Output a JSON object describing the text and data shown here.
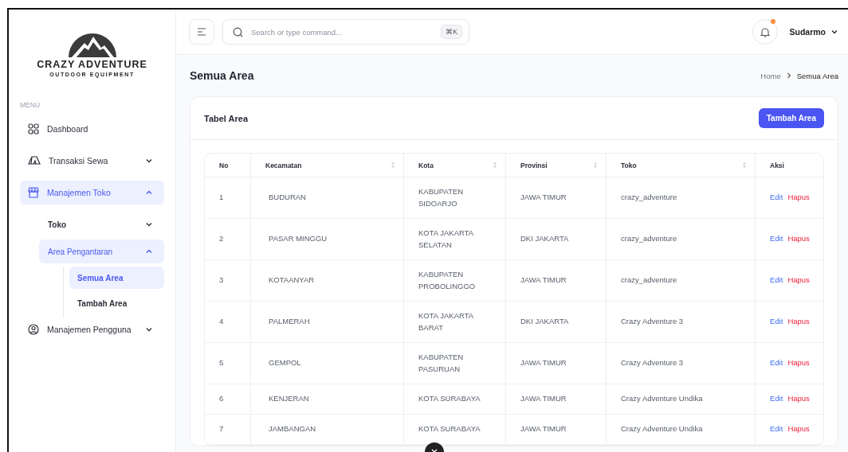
{
  "brand": {
    "name": "CRAZY ADVENTURE",
    "tagline": "OUTDOOR EQUIPMENT"
  },
  "sidebar": {
    "heading": "MENU",
    "items": [
      {
        "kind": "dashboard",
        "label": "Dashboard",
        "active": false
      },
      {
        "kind": "tent",
        "label": "Transaksi Sewa",
        "active": false,
        "expanded": false
      },
      {
        "kind": "store",
        "label": "Manajemen Toko",
        "active": true,
        "expanded": true,
        "children": [
          {
            "label": "Toko",
            "active": false,
            "expanded": false
          },
          {
            "label": "Area Pengantaran",
            "active": true,
            "expanded": true,
            "children": [
              {
                "label": "Semua Area",
                "selected": true
              },
              {
                "label": "Tambah Area",
                "selected": false
              }
            ]
          }
        ]
      },
      {
        "kind": "user",
        "label": "Manajemen Pengguna",
        "active": false,
        "expanded": false
      }
    ]
  },
  "header": {
    "search_placeholder": "Search or type command...",
    "shortcut": "⌘K",
    "notification": true,
    "user": "Sudarmo"
  },
  "page": {
    "title": "Semua Area",
    "breadcrumb": [
      "Home",
      "Semua Area"
    ]
  },
  "card": {
    "title": "Tabel Area",
    "add_button": "Tambah Area"
  },
  "table": {
    "columns": [
      {
        "label": "No",
        "sortable": false
      },
      {
        "label": "Kecamatan",
        "sortable": true
      },
      {
        "label": "Kota",
        "sortable": true
      },
      {
        "label": "Provinsi",
        "sortable": true
      },
      {
        "label": "Toko",
        "sortable": true
      },
      {
        "label": "Aksi",
        "sortable": false
      }
    ],
    "rows": [
      {
        "no": "1",
        "kecamatan": "BUDURAN",
        "kota": "KABUPATEN SIDOARJO",
        "provinsi": "JAWA TIMUR",
        "toko": "crazy_adventure",
        "actions": [
          "Edit",
          "Hapus"
        ]
      },
      {
        "no": "2",
        "kecamatan": "PASAR MINGGU",
        "kota": "KOTA JAKARTA SELATAN",
        "provinsi": "DKI JAKARTA",
        "toko": "crazy_adventure",
        "actions": [
          "Edit",
          "Hapus"
        ]
      },
      {
        "no": "3",
        "kecamatan": "KOTAANYAR",
        "kota": "KABUPATEN PROBOLINGGO",
        "provinsi": "JAWA TIMUR",
        "toko": "crazy_adventure",
        "actions": [
          "Edit",
          "Hapus"
        ]
      },
      {
        "no": "4",
        "kecamatan": "PALMERAH",
        "kota": "KOTA JAKARTA BARAT",
        "provinsi": "DKI JAKARTA",
        "toko": "Crazy Adventure 3",
        "actions": [
          "Edit",
          "Hapus"
        ]
      },
      {
        "no": "5",
        "kecamatan": "GEMPOL",
        "kota": "KABUPATEN PASURUAN",
        "provinsi": "JAWA TIMUR",
        "toko": "Crazy Adventure 3",
        "actions": [
          "Edit",
          "Hapus"
        ]
      },
      {
        "no": "6",
        "kecamatan": "KENJERAN",
        "kota": "KOTA SURABAYA",
        "provinsi": "JAWA TIMUR",
        "toko": "Crazy Adventure Undika",
        "actions": [
          "Edit",
          "Hapus"
        ]
      },
      {
        "no": "7",
        "kecamatan": "JAMBANGAN",
        "kota": "KOTA SURABAYA",
        "provinsi": "JAWA TIMUR",
        "toko": "Crazy Adventure Undika",
        "actions": [
          "Edit",
          "Hapus"
        ]
      }
    ]
  }
}
